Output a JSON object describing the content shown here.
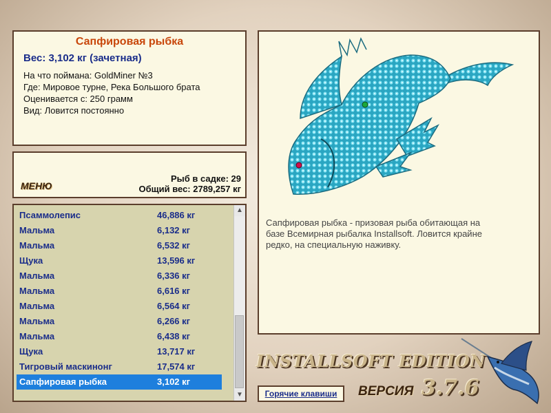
{
  "info": {
    "title": "Сапфировая рыбка",
    "weight": "Вес: 3,102 кг (зачетная)",
    "lines": [
      "На что поймана: GoldMiner №3",
      "Где: Мировое турне, Река Большого брата",
      "Оценивается с: 250 грамм",
      "Вид: Ловится постоянно"
    ]
  },
  "summary": {
    "menu_label": "МЕНЮ",
    "fish_count": "Рыб в садке: 29",
    "total_weight": "Общий вес: 2789,257 кг"
  },
  "catch_list": [
    {
      "name": "Псаммолепис",
      "weight": "46,886 кг"
    },
    {
      "name": "Мальма",
      "weight": "6,132 кг"
    },
    {
      "name": "Мальма",
      "weight": "6,532 кг"
    },
    {
      "name": "Щука",
      "weight": "13,596 кг"
    },
    {
      "name": "Мальма",
      "weight": "6,336 кг"
    },
    {
      "name": "Мальма",
      "weight": "6,616 кг"
    },
    {
      "name": "Мальма",
      "weight": "6,564 кг"
    },
    {
      "name": "Мальма",
      "weight": "6,266 кг"
    },
    {
      "name": "Мальма",
      "weight": "6,438 кг"
    },
    {
      "name": "Щука",
      "weight": "13,717 кг"
    },
    {
      "name": "Тигровый маскинонг",
      "weight": "17,574 кг"
    },
    {
      "name": "Сапфировая рыбка",
      "weight": "3,102 кг",
      "selected": true
    }
  ],
  "description": "Сапфировая рыбка - призовая рыба обитающая на базе Всемирная рыбалка Installsoft. Ловится крайне редко, на специальную наживку.",
  "footer": {
    "edition": "INSTALLSOFT EDITION",
    "version_label": "ВЕРСИЯ",
    "version": "3.7.6",
    "hotkeys": "Горячие клавиши"
  },
  "colors": {
    "selected_row": "#1e7fdd",
    "fish_body": "#3cc0d8",
    "title_accent": "#c8460a",
    "text_blue": "#1a2d8a"
  }
}
